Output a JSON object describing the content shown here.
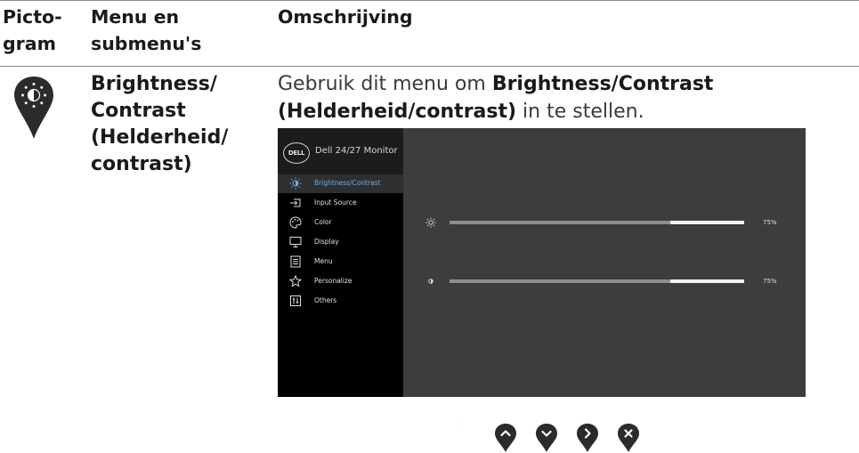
{
  "header": {
    "col1": "Picto-\ngram",
    "col2": "Menu en\nsubmenu's",
    "col3": "Omschrijving"
  },
  "row": {
    "pin_icon": "brightness-pin-icon",
    "submenu": "Brightness/\nContrast\n(Helderheid/\ncontrast)",
    "desc_pre": "Gebruik dit menu om ",
    "desc_bold": "Brightness/Contrast (Helderheid/contrast)",
    "desc_post": " in te stellen."
  },
  "osd": {
    "brand": "DELL",
    "title": "Dell 24/27 Monitor",
    "menu": [
      {
        "label": "Brightness/Contrast",
        "icon": "brightness-icon",
        "active": true
      },
      {
        "label": "Input Source",
        "icon": "input-source-icon"
      },
      {
        "label": "Color",
        "icon": "color-palette-icon"
      },
      {
        "label": "Display",
        "icon": "display-monitor-icon"
      },
      {
        "label": "Menu",
        "icon": "menu-list-icon"
      },
      {
        "label": "Personalize",
        "icon": "star-icon"
      },
      {
        "label": "Others",
        "icon": "others-sliders-icon"
      }
    ],
    "sliders": [
      {
        "name": "brightness",
        "icon": "sun-icon",
        "value": 75,
        "label": "75%"
      },
      {
        "name": "contrast",
        "icon": "contrast-icon",
        "value": 75,
        "label": "75%"
      }
    ]
  },
  "nav_buttons": [
    "up-button",
    "down-button",
    "right-button",
    "exit-button"
  ],
  "colors": {
    "pin": "#2b2b2b",
    "osd_bg": "#3d3d3d",
    "sidebar": "#000000",
    "active_text": "#6aaee8"
  }
}
